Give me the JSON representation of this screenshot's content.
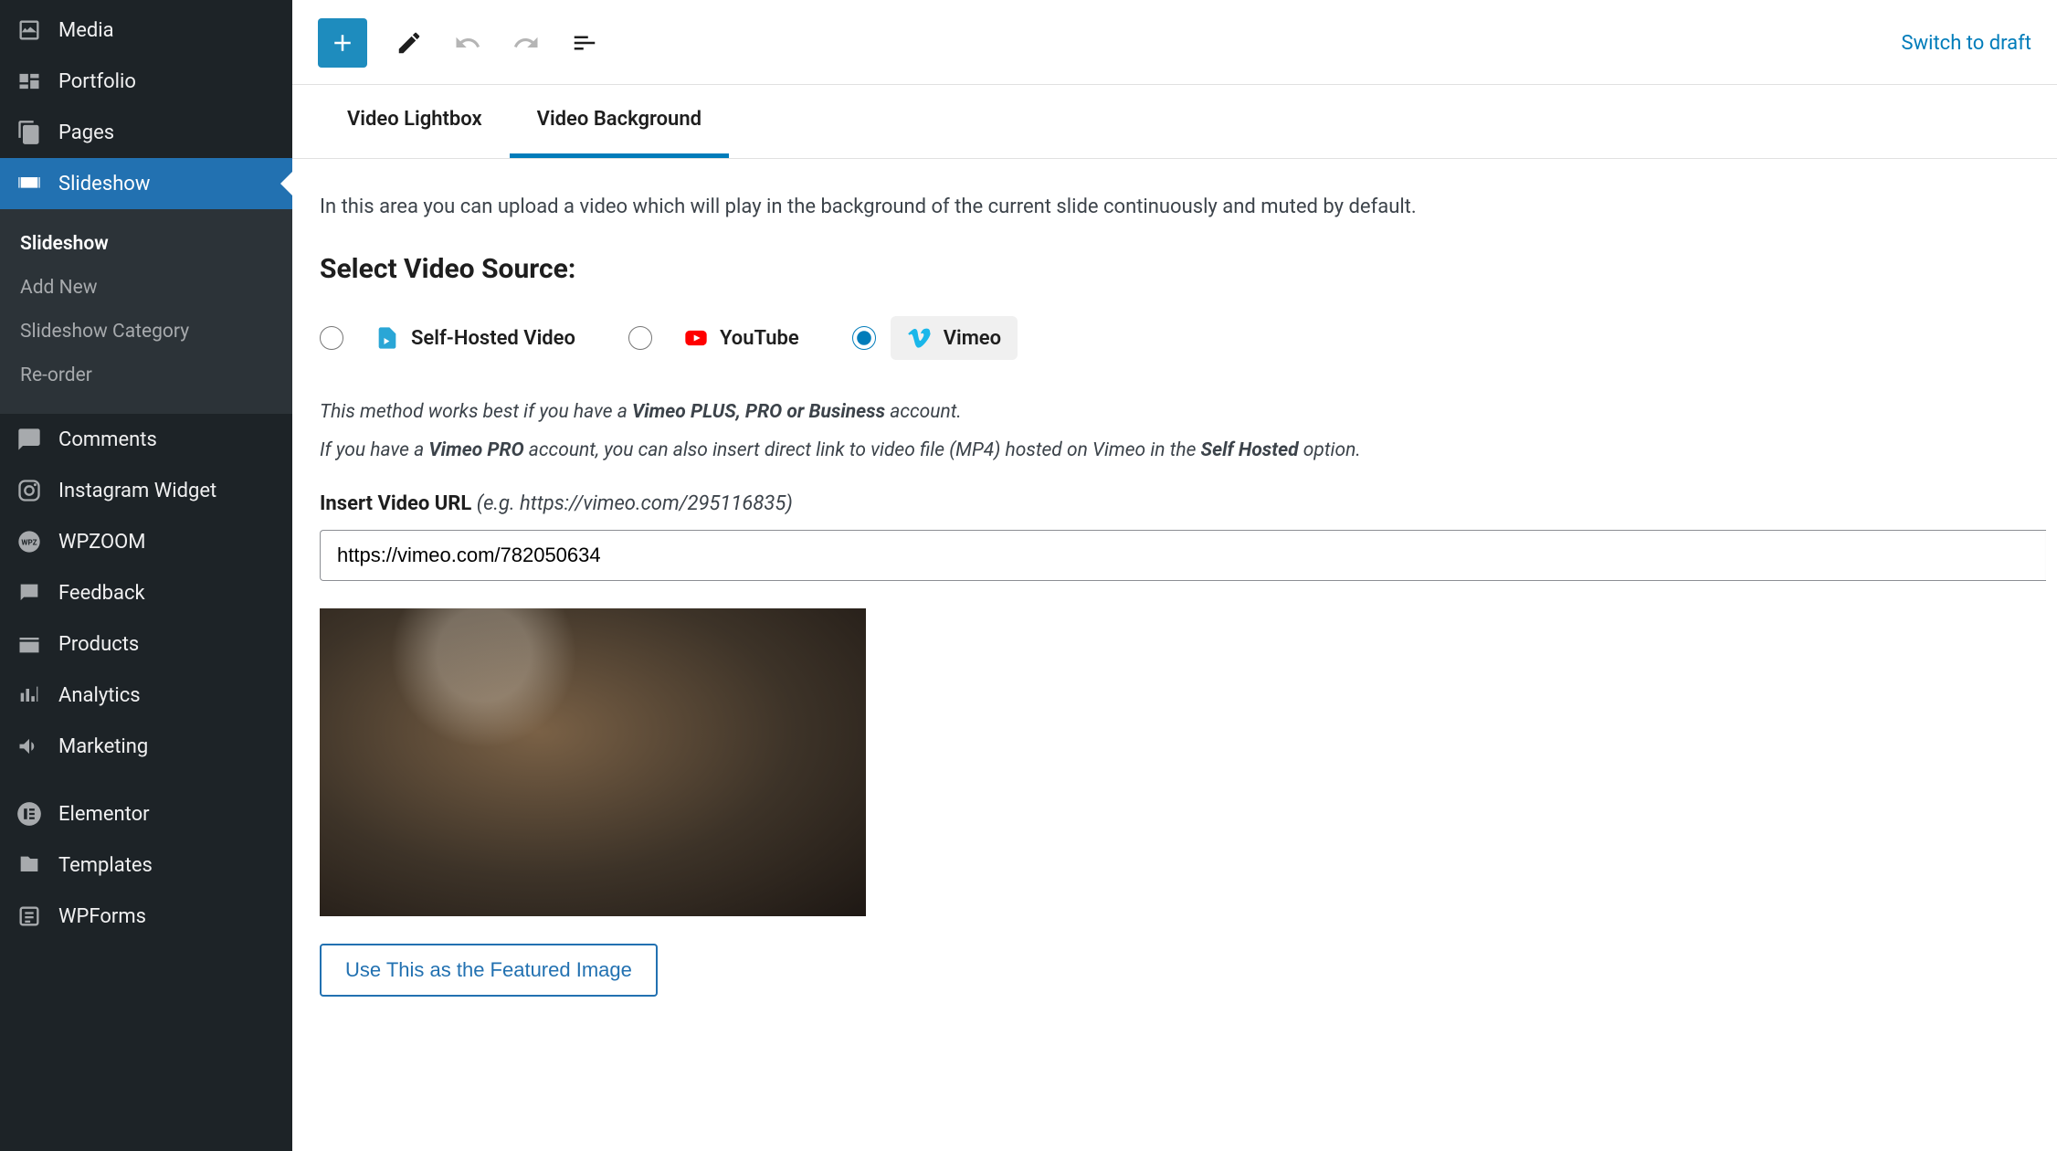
{
  "header": {
    "switch_draft": "Switch to draft"
  },
  "sidebar": {
    "items": [
      {
        "label": "Media",
        "icon": "media"
      },
      {
        "label": "Portfolio",
        "icon": "portfolio"
      },
      {
        "label": "Pages",
        "icon": "pages"
      },
      {
        "label": "Slideshow",
        "icon": "slideshow",
        "active": true
      },
      {
        "label": "Comments",
        "icon": "comments"
      },
      {
        "label": "Instagram Widget",
        "icon": "instagram"
      },
      {
        "label": "WPZOOM",
        "icon": "wpzoom"
      },
      {
        "label": "Feedback",
        "icon": "feedback"
      },
      {
        "label": "Products",
        "icon": "products"
      },
      {
        "label": "Analytics",
        "icon": "analytics"
      },
      {
        "label": "Marketing",
        "icon": "marketing"
      },
      {
        "label": "Elementor",
        "icon": "elementor"
      },
      {
        "label": "Templates",
        "icon": "templates"
      },
      {
        "label": "WPForms",
        "icon": "wpforms"
      }
    ],
    "submenu": [
      {
        "label": "Slideshow",
        "current": true
      },
      {
        "label": "Add New"
      },
      {
        "label": "Slideshow Category"
      },
      {
        "label": "Re-order"
      }
    ]
  },
  "tabs": {
    "lightbox": "Video Lightbox",
    "background": "Video Background"
  },
  "content": {
    "description": "In this area you can upload a video which will play in the background of the current slide continuously and muted by default.",
    "section_title": "Select Video Source:",
    "sources": {
      "self_hosted": "Self-Hosted Video",
      "youtube": "YouTube",
      "vimeo": "Vimeo"
    },
    "note_line1_a": "This method works best if you have a ",
    "note_line1_b": "Vimeo PLUS, PRO or Business",
    "note_line1_c": " account.",
    "note_line2_a": "If you have a ",
    "note_line2_b": "Vimeo PRO",
    "note_line2_c": " account, you can also insert direct link to video file (MP4) hosted on Vimeo in the ",
    "note_line2_d": "Self Hosted",
    "note_line2_e": " option.",
    "url_label": "Insert Video URL",
    "url_hint": "(e.g. https://vimeo.com/295116835)",
    "url_value": "https://vimeo.com/782050634",
    "featured_btn": "Use This as the Featured Image"
  }
}
